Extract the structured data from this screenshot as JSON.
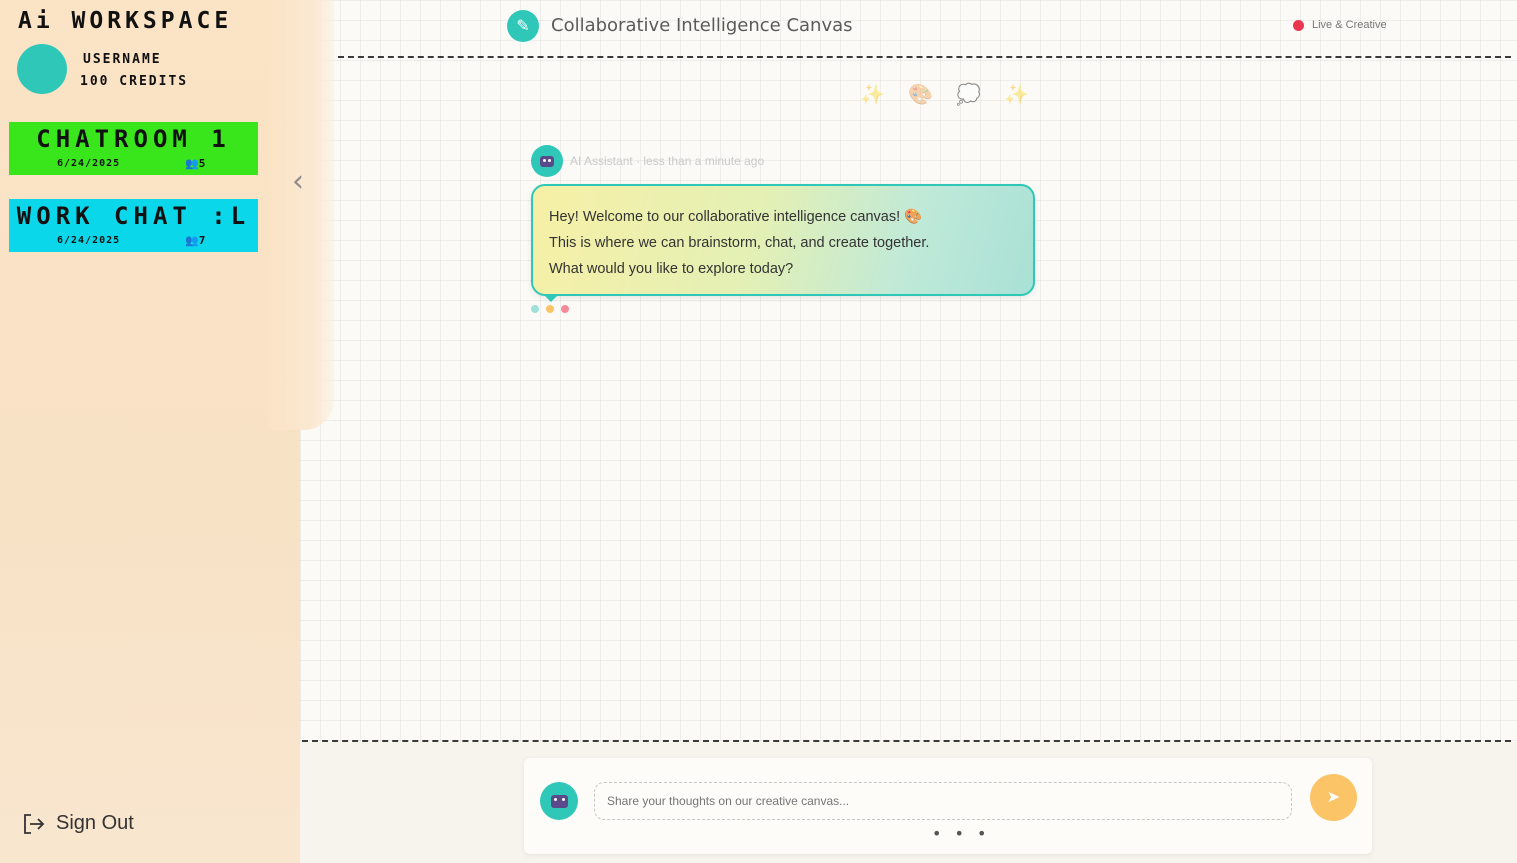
{
  "sidebar": {
    "app_title": "Ai WORKSPACE",
    "username": "USERNAME",
    "credits": "100 CREDITS",
    "rooms": [
      {
        "name": "CHATROOM 1",
        "date": "6/24/2025",
        "users": "5",
        "color": "#39e61c"
      },
      {
        "name": "WORK CHAT :L",
        "date": "6/24/2025",
        "users": "7",
        "color": "#0ad8ea"
      }
    ],
    "collapse_icon": "chevron-left-icon",
    "signout_label": "Sign Out"
  },
  "header": {
    "title": "Collaborative Intelligence Canvas",
    "status_text": "Live & Creative",
    "status_color": "#e8374f",
    "accent_color": "#2fc8b8"
  },
  "decorations": [
    "✨",
    "🎨",
    "💭",
    "✨"
  ],
  "messages": [
    {
      "author": "AI Assistant",
      "time": "less than a minute ago",
      "lines": [
        "Hey! Welcome to our collaborative intelligence canvas! 🎨",
        "This is where we can brainstorm, chat, and create together.",
        "What would you like to explore today?"
      ]
    }
  ],
  "typing_dot_colors": [
    "#9fe0d8",
    "#fbc466",
    "#f58a9a"
  ],
  "composer": {
    "placeholder": "Share your thoughts on our creative canvas...",
    "value": "",
    "send_icon": "send-icon",
    "more": "• • •"
  }
}
